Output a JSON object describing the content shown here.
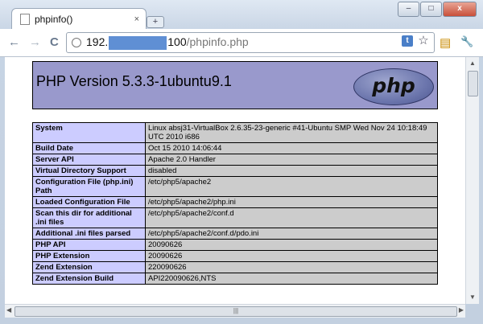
{
  "window": {
    "tab_title": "phpinfo()",
    "tab_close": "×",
    "new_tab": "+",
    "controls": {
      "minimize": "–",
      "maximize": "□",
      "close": "x"
    }
  },
  "toolbar": {
    "back": "←",
    "forward": "→",
    "reload": "C",
    "url_host": "192.",
    "url_suffix": "100",
    "url_path": "/phpinfo.php",
    "bookmark_star": "☆",
    "page_icon": "▤",
    "wrench": "🔧",
    "extension_label": "t",
    "accent": "#5f8fd4"
  },
  "page": {
    "header": "PHP Version 5.3.3-1ubuntu9.1",
    "logo_text": "php",
    "rows": [
      {
        "key": "System",
        "value": "Linux absj31-VirtualBox 2.6.35-23-generic #41-Ubuntu SMP Wed Nov 24 10:18:49 UTC 2010 i686"
      },
      {
        "key": "Build Date",
        "value": "Oct 15 2010 14:06:44"
      },
      {
        "key": "Server API",
        "value": "Apache 2.0 Handler"
      },
      {
        "key": "Virtual Directory Support",
        "value": "disabled"
      },
      {
        "key": "Configuration File (php.ini) Path",
        "value": "/etc/php5/apache2"
      },
      {
        "key": "Loaded Configuration File",
        "value": "/etc/php5/apache2/php.ini"
      },
      {
        "key": "Scan this dir for additional .ini files",
        "value": "/etc/php5/apache2/conf.d"
      },
      {
        "key": "Additional .ini files parsed",
        "value": "/etc/php5/apache2/conf.d/pdo.ini"
      },
      {
        "key": "PHP API",
        "value": "20090626"
      },
      {
        "key": "PHP Extension",
        "value": "20090626"
      },
      {
        "key": "Zend Extension",
        "value": "220090626"
      },
      {
        "key": "Zend Extension Build",
        "value": "API220090626,NTS"
      }
    ]
  },
  "scroll": {
    "up": "▲",
    "down": "▼",
    "left": "◀",
    "right": "▶",
    "grip": "|||"
  }
}
